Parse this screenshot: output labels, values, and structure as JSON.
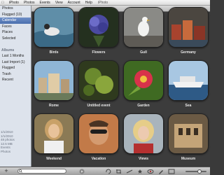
{
  "menubar": {
    "apple": "",
    "items": [
      "iPhoto",
      "Photos",
      "Events",
      "View",
      "Account",
      "Help"
    ],
    "window_title": "iPhoto"
  },
  "sidebar": {
    "rows": [
      "Photos",
      "Flagged (10)",
      "Calendar",
      "Faces",
      "Places",
      "Selected",
      "",
      "Albums",
      "Last 1 Months",
      "Last Import (1)",
      "Flagged",
      "Trash",
      "Recent"
    ],
    "selected_index": 2,
    "info": [
      "1/1/2010",
      "1/1/2010",
      "48 photos",
      "12.5 MB",
      "Events",
      "Photos"
    ]
  },
  "events": [
    {
      "name": "Birds",
      "theme": "bird-water"
    },
    {
      "name": "Flowers",
      "theme": "purple-flower"
    },
    {
      "name": "Gull",
      "theme": "gull"
    },
    {
      "name": "Germany",
      "theme": "town"
    },
    {
      "name": "Rome",
      "theme": "city"
    },
    {
      "name": "Untitled event",
      "theme": "green-leaves"
    },
    {
      "name": "Garden",
      "theme": "red-flower"
    },
    {
      "name": "Sea",
      "theme": "ship"
    },
    {
      "name": "Weekend",
      "theme": "woman"
    },
    {
      "name": "Vacation",
      "theme": "man"
    },
    {
      "name": "Views",
      "theme": "blonde"
    },
    {
      "name": "Museum",
      "theme": "building"
    }
  ],
  "toolbar": {
    "add": "+",
    "search_placeholder": ""
  }
}
